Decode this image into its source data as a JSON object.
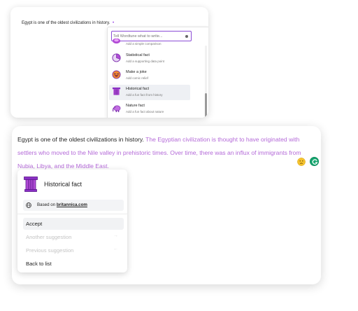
{
  "top_card": {
    "sentence": "Egypt is one of the oldest civilizations in history.",
    "cursor_mark": "•",
    "dropdown": {
      "placeholder": "Tell Wordtune what to write...",
      "items": [
        {
          "title": "",
          "subtitle": "Add a simple comparison",
          "icon": "comparison-icon"
        },
        {
          "title": "Statistical fact",
          "subtitle": "Add a supporting data point",
          "icon": "pie-chart-icon"
        },
        {
          "title": "Make a joke",
          "subtitle": "Add comic relief",
          "icon": "laughing-face-icon"
        },
        {
          "title": "Historical fact",
          "subtitle": "Add a fun fact from history",
          "icon": "column-icon",
          "active": true
        },
        {
          "title": "Nature fact",
          "subtitle": "Add a fun fact about nature",
          "icon": "elephant-icon"
        }
      ]
    }
  },
  "bottom_card": {
    "sentence": "Egypt is one of the oldest civilizations in history.",
    "suggestion": "The Egyptian civilization is thought to have originated with settlers who moved to the Nile valley in prehistoric times. Over time, there was an influx of immigrants from Nubia, Libya, and the Middle East.",
    "popup": {
      "title": "Historical fact",
      "source_prefix": "Based on",
      "source_link": "britannica.com",
      "actions": {
        "accept": "Accept",
        "another": "Another suggestion",
        "previous": "Previous suggestion",
        "back": "Back to list"
      },
      "arrows": {
        "another": "→",
        "previous": "←"
      }
    }
  },
  "colors": {
    "accent": "#8b4dd6",
    "suggestion_text": "#b46ad8",
    "grammarly_green": "#15a66f"
  }
}
